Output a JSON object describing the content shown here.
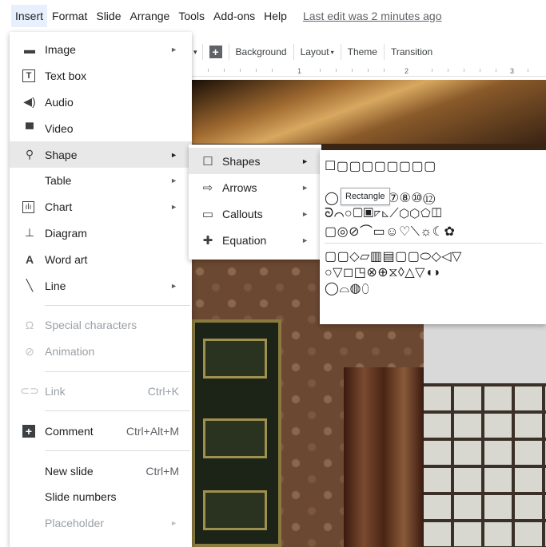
{
  "menubar": {
    "items": [
      "Insert",
      "Format",
      "Slide",
      "Arrange",
      "Tools",
      "Add-ons",
      "Help"
    ],
    "last_edit": "Last edit was 2 minutes ago"
  },
  "toolbar": {
    "background_label": "Background",
    "layout_label": "Layout",
    "theme_label": "Theme",
    "transition_label": "Transition"
  },
  "ruler": {
    "numbers": [
      "1",
      "2",
      "3"
    ]
  },
  "insert_menu": {
    "image": "Image",
    "text_box": "Text box",
    "audio": "Audio",
    "video": "Video",
    "shape": "Shape",
    "table": "Table",
    "chart": "Chart",
    "diagram": "Diagram",
    "word_art": "Word art",
    "line": "Line",
    "special_characters": "Special characters",
    "animation": "Animation",
    "link": "Link",
    "link_shortcut": "Ctrl+K",
    "comment": "Comment",
    "comment_shortcut": "Ctrl+Alt+M",
    "new_slide": "New slide",
    "new_slide_shortcut": "Ctrl+M",
    "slide_numbers": "Slide numbers",
    "placeholder": "Placeholder"
  },
  "shape_submenu": {
    "shapes": "Shapes",
    "arrows": "Arrows",
    "callouts": "Callouts",
    "equation": "Equation"
  },
  "shapes_palette": {
    "row1": "☐▢▢▢▢▢▢▢▢",
    "row2": "◯   ⏢◇⬠⑥⑦⑧⑩⑫",
    "row3": "ᘐ⌒○▢▣◸◺⟋⬡⬡⬠◫",
    "row4": "▢◎⊘⌒▭☺♡⟍☼☾✿",
    "row5": "▢▢◇▱▥▤▢▢⬭◇◁▽",
    "row6": "○▽◻◳⊗⊕⧖◊△▽◖◗",
    "row7": "◯⌓◍⬯",
    "tooltip": "Rectangle"
  }
}
